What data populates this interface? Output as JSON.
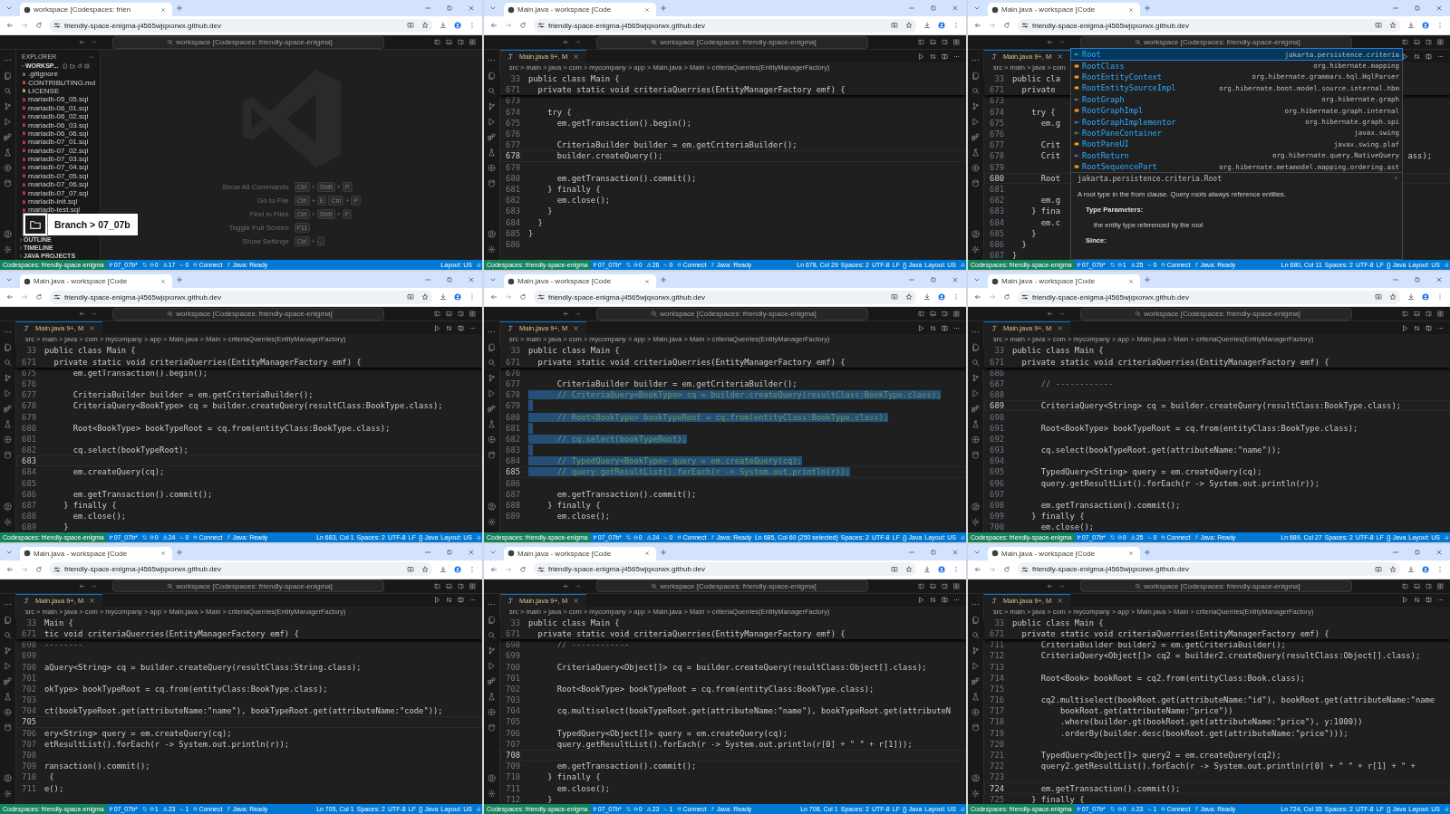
{
  "panels": [
    {
      "kind": "welcome",
      "browser_tab": "workspace [Codespaces: frien",
      "url": "friendly-space-enigma-j4565wjqxorwx.github.dev",
      "command_center": "workspace [Codespaces: friendly-space-enigma]",
      "explorer": {
        "title": "EXPLORER",
        "workspace": "WORKSP...",
        "files": [
          {
            "name": ".gitignore",
            "color": "#6d8086"
          },
          {
            "name": "CONTRIBUTING.md",
            "color": "#e05252"
          },
          {
            "name": "LICENSE",
            "color": "#cbcb41"
          },
          {
            "name": "mariadb-05_05.sql",
            "color": "#d6336c"
          },
          {
            "name": "mariadb-06_01.sql",
            "color": "#d6336c"
          },
          {
            "name": "mariadb-06_02.sql",
            "color": "#d6336c"
          },
          {
            "name": "mariadb-06_03.sql",
            "color": "#d6336c"
          },
          {
            "name": "mariadb-06_06.sql",
            "color": "#d6336c"
          },
          {
            "name": "mariadb-07_01.sql",
            "color": "#d6336c"
          },
          {
            "name": "mariadb-07_02.sql",
            "color": "#d6336c"
          },
          {
            "name": "mariadb-07_03.sql",
            "color": "#d6336c"
          },
          {
            "name": "mariadb-07_04.sql",
            "color": "#d6336c"
          },
          {
            "name": "mariadb-07_05.sql",
            "color": "#d6336c"
          },
          {
            "name": "mariadb-07_06.sql",
            "color": "#d6336c"
          },
          {
            "name": "mariadb-07_07.sql",
            "color": "#d6336c"
          },
          {
            "name": "mariadb-init.sql",
            "color": "#d6336c"
          },
          {
            "name": "mariadb-test.sql",
            "color": "#d6336c"
          }
        ],
        "sections": [
          "OUTLINE",
          "TIMELINE",
          "JAVA PROJECTS"
        ]
      },
      "shortcuts": [
        {
          "label": "Show All Commands",
          "keys": [
            {
              "kind": "key",
              "text": "Ctrl"
            },
            {
              "kind": "sep",
              "text": "+"
            },
            {
              "kind": "key",
              "text": "Shift"
            },
            {
              "kind": "sep",
              "text": "+"
            },
            {
              "kind": "key",
              "text": "P"
            }
          ]
        },
        {
          "label": "Go to File",
          "keys": [
            {
              "kind": "key",
              "text": "Ctrl"
            },
            {
              "kind": "sep",
              "text": "+"
            },
            {
              "kind": "key",
              "text": "E"
            },
            {
              "kind": "key",
              "text": "Ctrl"
            },
            {
              "kind": "sep",
              "text": "+"
            },
            {
              "kind": "key",
              "text": "P"
            }
          ]
        },
        {
          "label": "Find in Files",
          "keys": [
            {
              "kind": "key",
              "text": "Ctrl"
            },
            {
              "kind": "sep",
              "text": "+"
            },
            {
              "kind": "key",
              "text": "Shift"
            },
            {
              "kind": "sep",
              "text": "+"
            },
            {
              "kind": "key",
              "text": "F"
            }
          ]
        },
        {
          "label": "Toggle Full Screen",
          "keys": [
            {
              "kind": "key",
              "text": "F11"
            }
          ]
        },
        {
          "label": "Show Settings",
          "keys": [
            {
              "kind": "key",
              "text": "Ctrl"
            },
            {
              "kind": "sep",
              "text": "+"
            },
            {
              "kind": "key",
              "text": ","
            }
          ]
        }
      ],
      "branch_overlay": "Branch > 07_07b",
      "status": {
        "remote": "Codespaces: friendly-space-enigma",
        "branch": "07_07b*",
        "errors": "0",
        "warnings": "17",
        "ports": "0",
        "connect": "Connect",
        "java": "Java: Ready",
        "right": [
          "Layout: US"
        ]
      }
    },
    {
      "kind": "editor",
      "browser_tab": "Main.java - workspace [Code",
      "url": "friendly-space-enigma-j4565wjqxorwx.github.dev",
      "command_center": "workspace [Codespaces: friendly-space-enigma]",
      "editor_tab": "Main.java 9+, M",
      "breadcrumb": "src > main > java > com > mycompany > app > Main.java > Main > criteriaQuerries(EntityManagerFactory)",
      "sticky": [
        {
          "n": "33",
          "text": "public class Main {"
        },
        {
          "n": "671",
          "text": "  private static void criteriaQuerries(EntityManagerFactory emf) {"
        }
      ],
      "lines": [
        {
          "n": "673",
          "current": false
        },
        {
          "n": "674",
          "text": "    try {",
          "current": false
        },
        {
          "n": "675",
          "text": "      em.getTransaction().begin();",
          "current": false
        },
        {
          "n": "676",
          "current": false
        },
        {
          "n": "677",
          "text": "      CriteriaBuilder builder = em.getCriteriaBuilder();",
          "current": false
        },
        {
          "n": "678",
          "text": "      builder.createQuery();",
          "current": true
        },
        {
          "n": "679",
          "current": false
        },
        {
          "n": "680",
          "text": "      em.getTransaction().commit();",
          "current": false
        },
        {
          "n": "681",
          "text": "    } finally {",
          "current": false
        },
        {
          "n": "682",
          "text": "      em.close();",
          "current": false
        },
        {
          "n": "683",
          "text": "    }",
          "current": false
        },
        {
          "n": "684",
          "text": "  }",
          "current": false
        },
        {
          "n": "685",
          "text": "}",
          "current": false
        },
        {
          "n": "686",
          "current": false
        }
      ],
      "status": {
        "remote": "Codespaces: friendly-space-enigma",
        "branch": "07_07b*",
        "errors": "0",
        "warnings": "26",
        "ports": "0",
        "connect": "Connect",
        "java": "Java: Ready",
        "right": [
          "Ln 678, Col 29",
          "Spaces: 2",
          "UTF-8",
          "LF",
          "{} Java",
          "Layout: US"
        ]
      }
    },
    {
      "kind": "editor",
      "browser_tab": "Main.java - workspace [Code",
      "url": "friendly-space-enigma-j4565wjqxorwx.github.dev",
      "command_center": "workspace [Codespaces: friendly-space-enigma]",
      "editor_tab": "Main.java 9+, M",
      "breadcrumb": "src > main > java > com",
      "sticky": [
        {
          "n": "33",
          "text": "public cla"
        },
        {
          "n": "671",
          "text": "  private"
        }
      ],
      "lines": [
        {
          "n": "673",
          "current": false
        },
        {
          "n": "674",
          "text": "    try {",
          "current": false
        },
        {
          "n": "675",
          "text": "      em.g",
          "current": false
        },
        {
          "n": "676",
          "current": false
        },
        {
          "n": "677",
          "text": "      Crit",
          "current": false
        },
        {
          "n": "678",
          "text": "      Crit",
          "tail": "ass);",
          "current": false
        },
        {
          "n": "679",
          "current": false
        },
        {
          "n": "680",
          "text": "      Root",
          "current": true
        },
        {
          "n": "681",
          "current": false
        },
        {
          "n": "682",
          "text": "      em.g",
          "current": false
        },
        {
          "n": "683",
          "text": "    } fina",
          "current": false
        },
        {
          "n": "684",
          "text": "      em.c",
          "current": false
        },
        {
          "n": "685",
          "text": "    }",
          "current": false
        },
        {
          "n": "686",
          "text": "  }",
          "current": false
        },
        {
          "n": "687",
          "text": "}",
          "current": false
        }
      ],
      "suggest": {
        "items": [
          {
            "label": "Root",
            "detail": "jakarta.persistence.criteria",
            "kind": "interface",
            "selected": true
          },
          {
            "label": "RootClass",
            "detail": "org.hibernate.mapping",
            "kind": "class",
            "selected": false
          },
          {
            "label": "RootEntityContext",
            "detail": "org.hibernate.grammars.hql.HqlParser",
            "kind": "class",
            "selected": false
          },
          {
            "label": "RootEntitySourceImpl",
            "detail": "org.hibernate.boot.model.source.internal.hbm",
            "kind": "class",
            "selected": false
          },
          {
            "label": "RootGraph",
            "detail": "org.hibernate.graph",
            "kind": "interface",
            "selected": false
          },
          {
            "label": "RootGraphImpl",
            "detail": "org.hibernate.graph.internal",
            "kind": "class",
            "selected": false
          },
          {
            "label": "RootGraphImplementor",
            "detail": "org.hibernate.graph.spi",
            "kind": "interface",
            "selected": false
          },
          {
            "label": "RootPaneContainer",
            "detail": "javax.swing",
            "kind": "interface",
            "selected": false
          },
          {
            "label": "RootPaneUI",
            "detail": "javax.swing.plaf",
            "kind": "class",
            "selected": false
          },
          {
            "label": "RootReturn",
            "detail": "org.hibernate.query.NativeQuery",
            "kind": "interface",
            "selected": false
          },
          {
            "label": "RootSequencePart",
            "detail": "org.hibernate.metamodel.mapping.ordering.ast",
            "kind": "class",
            "selected": false
          }
        ],
        "details": {
          "signature": "jakarta.persistence.criteria.Root",
          "description": "A root type in the from clause. Query roots always reference entities.",
          "sections": [
            {
              "title": "Type Parameters:",
              "items": [
                "the entity type referenced by the root"
              ]
            },
            {
              "title": "Since:"
            }
          ]
        }
      },
      "status": {
        "remote": "Codespaces: friendly-space-enigma",
        "branch": "07_07b*",
        "errors": "1",
        "warnings": "25",
        "ports": "0",
        "connect": "Connect",
        "java": "Java: Ready",
        "right": [
          "Ln 680, Col 11",
          "Spaces: 2",
          "UTF-8",
          "LF",
          "{} Java",
          "Layout: US"
        ]
      }
    },
    {
      "kind": "editor",
      "browser_tab": "Main.java - workspace [Code",
      "url": "friendly-space-enigma-j4565wjqxorwx.github.dev",
      "command_center": "workspace [Codespaces: friendly-space-enigma]",
      "editor_tab": "Main.java 9+, M",
      "breadcrumb": "src > main > java > com > mycompany > app > Main.java > Main > criteriaQuerries(EntityManagerFactory)",
      "sticky": [
        {
          "n": "33",
          "text": "public class Main {"
        },
        {
          "n": "671",
          "text": "  private static void criteriaQuerries(EntityManagerFactory emf) {"
        }
      ],
      "lines": [
        {
          "n": "675",
          "text": "      em.getTransaction().begin();",
          "current": false
        },
        {
          "n": "676",
          "current": false
        },
        {
          "n": "677",
          "text": "      CriteriaBuilder builder = em.getCriteriaBuilder();",
          "current": false
        },
        {
          "n": "678",
          "text": "      CriteriaQuery<BookType> cq = builder.createQuery(resultClass:BookType.class);",
          "current": false
        },
        {
          "n": "679",
          "current": false
        },
        {
          "n": "680",
          "text": "      Root<BookType> bookTypeRoot = cq.from(entityClass:BookType.class);",
          "current": false
        },
        {
          "n": "681",
          "current": false
        },
        {
          "n": "682",
          "text": "      cq.select(bookTypeRoot);",
          "current": false
        },
        {
          "n": "683",
          "current": true
        },
        {
          "n": "684",
          "text": "      em.createQuery(cq);",
          "current": false
        },
        {
          "n": "685",
          "current": false
        },
        {
          "n": "686",
          "text": "      em.getTransaction().commit();",
          "current": false
        },
        {
          "n": "687",
          "text": "    } finally {",
          "current": false
        },
        {
          "n": "688",
          "text": "      em.close();",
          "current": false
        },
        {
          "n": "689",
          "text": "    }",
          "current": false
        }
      ],
      "status": {
        "remote": "Codespaces: friendly-space-enigma",
        "branch": "07_07b*",
        "errors": "0",
        "warnings": "24",
        "ports": "0",
        "connect": "Connect",
        "java": "Java: Ready",
        "right": [
          "Ln 683, Col 1",
          "Spaces: 2",
          "UTF-8",
          "LF",
          "{} Java",
          "Layout: US"
        ]
      }
    },
    {
      "kind": "editor",
      "browser_tab": "Main.java - workspace [Code",
      "url": "friendly-space-enigma-j4565wjqxorwx.github.dev",
      "command_center": "workspace [Codespaces: friendly-space-enigma]",
      "editor_tab": "Main.java 9+, M",
      "breadcrumb": "src > main > java > com > mycompany > app > Main.java > Main > criteriaQuerries(EntityManagerFactory)",
      "sticky": [
        {
          "n": "33",
          "text": "public class Main {"
        },
        {
          "n": "671",
          "text": "  private static void criteriaQuerries(EntityManagerFactory emf) {"
        }
      ],
      "lines": [
        {
          "n": "676",
          "current": false,
          "selected": false
        },
        {
          "n": "677",
          "text": "      CriteriaBuilder builder = em.getCriteriaBuilder();",
          "current": false,
          "comment": false,
          "selected": false
        },
        {
          "n": "678",
          "text": "      // CriteriaQuery<BookType> cq = builder.createQuery(resultClass:BookType.class);",
          "current": false,
          "comment": true,
          "selected": true
        },
        {
          "n": "679",
          "current": false,
          "selected": true
        },
        {
          "n": "680",
          "text": "      // Root<BookType> bookTypeRoot = cq.from(entityClass:BookType.class);",
          "current": false,
          "comment": true,
          "selected": true
        },
        {
          "n": "681",
          "current": false,
          "selected": true
        },
        {
          "n": "682",
          "text": "      // cq.select(bookTypeRoot);",
          "current": false,
          "comment": true,
          "selected": true
        },
        {
          "n": "683",
          "current": false,
          "selected": true
        },
        {
          "n": "684",
          "text": "      // TypedQuery<BookType> query = em.createQuery(cq);",
          "current": false,
          "comment": true,
          "selected": true
        },
        {
          "n": "685",
          "text": "      // query.getResultList().forEach(r -> System.out.println(r));",
          "current": true,
          "comment": true,
          "selected": true
        },
        {
          "n": "686",
          "current": false,
          "selected": false
        },
        {
          "n": "687",
          "text": "      em.getTransaction().commit();",
          "current": false,
          "comment": false,
          "selected": false
        },
        {
          "n": "688",
          "text": "    } finally {",
          "current": false,
          "comment": false,
          "selected": false
        },
        {
          "n": "689",
          "text": "      em.close();",
          "current": false,
          "comment": false,
          "selected": false
        }
      ],
      "status": {
        "remote": "Codespaces: friendly-space-enigma",
        "branch": "07_07b*",
        "errors": "0",
        "warnings": "24",
        "ports": "0",
        "connect": "Connect",
        "java": "Java: Ready",
        "right": [
          "Ln 685, Col 60 (250 selected)",
          "Spaces: 2",
          "UTF-8",
          "LF",
          "{} Java",
          "Layout: US"
        ]
      }
    },
    {
      "kind": "editor",
      "browser_tab": "Main.java - workspace [Code",
      "url": "friendly-space-enigma-j4565wjqxorwx.github.dev",
      "command_center": "workspace [Codespaces: friendly-space-enigma]",
      "editor_tab": "Main.java 9+, M",
      "breadcrumb": "src > main > java > com > mycompany > app > Main.java > Main > criteriaQuerries(EntityManagerFactory)",
      "sticky": [
        {
          "n": "33",
          "text": "public class Main {"
        },
        {
          "n": "671",
          "text": "  private static void criteriaQuerries(EntityManagerFactory emf) {"
        }
      ],
      "lines": [
        {
          "n": "686",
          "current": false
        },
        {
          "n": "687",
          "text": "      // ------------",
          "current": false,
          "comment": true
        },
        {
          "n": "688",
          "current": false
        },
        {
          "n": "689",
          "text": "      CriteriaQuery<String> cq = builder.createQuery(resultClass:BookType.class);",
          "current": true,
          "comment": false
        },
        {
          "n": "690",
          "current": false
        },
        {
          "n": "691",
          "text": "      Root<BookType> bookTypeRoot = cq.from(entityClass:BookType.class);",
          "current": false,
          "comment": false
        },
        {
          "n": "692",
          "current": false
        },
        {
          "n": "693",
          "text": "      cq.select(bookTypeRoot.get(attributeName:\"name\"));",
          "current": false,
          "comment": false
        },
        {
          "n": "694",
          "current": false
        },
        {
          "n": "695",
          "text": "      TypedQuery<String> query = em.createQuery(cq);",
          "current": false,
          "comment": false
        },
        {
          "n": "696",
          "text": "      query.getResultList().forEach(r -> System.out.println(r));",
          "current": false,
          "comment": false
        },
        {
          "n": "697",
          "current": false
        },
        {
          "n": "698",
          "text": "      em.getTransaction().commit();",
          "current": false,
          "comment": false
        },
        {
          "n": "699",
          "text": "    } finally {",
          "current": false,
          "comment": false
        },
        {
          "n": "700",
          "text": "      em.close();",
          "current": false,
          "comment": false
        }
      ],
      "status": {
        "remote": "Codespaces: friendly-space-enigma",
        "branch": "07_07b*",
        "errors": "0",
        "warnings": "25",
        "ports": "0",
        "connect": "Connect",
        "java": "Java: Ready",
        "right": [
          "Ln 689, Col 27",
          "Spaces: 2",
          "UTF-8",
          "LF",
          "{} Java",
          "Layout: US"
        ]
      }
    },
    {
      "kind": "editor",
      "browser_tab": "Main.java - workspace [Code",
      "url": "friendly-space-enigma-j4565wjqxorwx.github.dev",
      "command_center": "workspace [Codespaces: friendly-space-enigma]",
      "editor_tab": "Main.java 9+, M",
      "breadcrumb": "src > main > java > com > mycompany > app > Main.java > Main > criteriaQuerries(EntityManagerFactory)",
      "sticky": [
        {
          "n": "33",
          "text": "Main {"
        },
        {
          "n": "671",
          "text": "tic void criteriaQuerries(EntityManagerFactory emf) {"
        }
      ],
      "lines": [
        {
          "n": "698",
          "text": "--------",
          "current": false,
          "comment": true
        },
        {
          "n": "699",
          "current": false
        },
        {
          "n": "700",
          "text": "aQuery<String> cq = builder.createQuery(resultClass:String.class);",
          "current": false,
          "comment": false
        },
        {
          "n": "701",
          "current": false
        },
        {
          "n": "702",
          "text": "okType> bookTypeRoot = cq.from(entityClass:BookType.class);",
          "current": false,
          "comment": false
        },
        {
          "n": "703",
          "current": false
        },
        {
          "n": "704",
          "text": "ct(bookTypeRoot.get(attributeName:\"name\"), bookTypeRoot.get(attributeName:\"code\"));",
          "current": false,
          "comment": false
        },
        {
          "n": "705",
          "current": true
        },
        {
          "n": "706",
          "text": "ery<String> query = em.createQuery(cq);",
          "current": false,
          "comment": false
        },
        {
          "n": "707",
          "text": "etResultList().forEach(r -> System.out.println(r));",
          "current": false,
          "comment": false
        },
        {
          "n": "708",
          "current": false
        },
        {
          "n": "709",
          "text": "ransaction().commit();",
          "current": false,
          "comment": false
        },
        {
          "n": "710",
          "text": " {",
          "current": false,
          "comment": false
        },
        {
          "n": "711",
          "text": "e();",
          "current": false,
          "comment": false
        }
      ],
      "status": {
        "remote": "Codespaces: friendly-space-enigma",
        "branch": "07_07b*",
        "errors": "1",
        "warnings": "23",
        "ports": "1",
        "connect": "Connect",
        "java": "Java: Ready",
        "right": [
          "Ln 705, Col 1",
          "Spaces: 2",
          "UTF-8",
          "LF",
          "{} Java",
          "Layout: US"
        ]
      }
    },
    {
      "kind": "editor",
      "browser_tab": "Main.java - workspace [Code",
      "url": "friendly-space-enigma-j4565wjqxorwx.github.dev",
      "command_center": "workspace [Codespaces: friendly-space-enigma]",
      "editor_tab": "Main.java 9+, M",
      "breadcrumb": "src > main > java > com > mycompany > app > Main.java > Main > criteriaQuerries(EntityManagerFactory)",
      "sticky": [
        {
          "n": "33",
          "text": "public class Main {"
        },
        {
          "n": "671",
          "text": "  private static void criteriaQuerries(EntityManagerFactory emf) {"
        }
      ],
      "lines": [
        {
          "n": "698",
          "text": "      // ------------",
          "current": false,
          "comment": true
        },
        {
          "n": "699",
          "current": false
        },
        {
          "n": "700",
          "text": "      CriteriaQuery<Object[]> cq = builder.createQuery(resultClass:Object[].class);",
          "current": false,
          "comment": false
        },
        {
          "n": "701",
          "current": false
        },
        {
          "n": "702",
          "text": "      Root<BookType> bookTypeRoot = cq.from(entityClass:BookType.class);",
          "current": false,
          "comment": false
        },
        {
          "n": "703",
          "current": false
        },
        {
          "n": "704",
          "text": "      cq.multiselect(bookTypeRoot.get(attributeName:\"name\"), bookTypeRoot.get(attributeN",
          "current": false,
          "comment": false
        },
        {
          "n": "705",
          "current": false
        },
        {
          "n": "706",
          "text": "      TypedQuery<Object[]> query = em.createQuery(cq);",
          "current": false,
          "comment": false
        },
        {
          "n": "707",
          "text": "      query.getResultList().forEach(r -> System.out.println(r[0] + \" \" + r[1]));",
          "current": false,
          "comment": false
        },
        {
          "n": "708",
          "current": true
        },
        {
          "n": "709",
          "text": "      em.getTransaction().commit();",
          "current": false,
          "comment": false
        },
        {
          "n": "710",
          "text": "    } finally {",
          "current": false,
          "comment": false
        },
        {
          "n": "711",
          "text": "      em.close();",
          "current": false,
          "comment": false
        },
        {
          "n": "712",
          "text": "    }",
          "current": false,
          "comment": false
        }
      ],
      "status": {
        "remote": "Codespaces: friendly-space-enigma",
        "branch": "07_07b*",
        "errors": "0",
        "warnings": "23",
        "ports": "1",
        "connect": "Connect",
        "java": "Java: Ready",
        "right": [
          "Ln 708, Col 1",
          "Spaces: 2",
          "UTF-8",
          "LF",
          "{} Java",
          "Layout: US"
        ]
      }
    },
    {
      "kind": "editor",
      "browser_tab": "Main.java - workspace [Code",
      "url": "friendly-space-enigma-j4565wjqxorwx.github.dev",
      "command_center": "workspace [Codespaces: friendly-space-enigma]",
      "editor_tab": "Main.java 9+, M",
      "breadcrumb": "src > main > java > com > mycompany > app > Main.java > Main > criteriaQuerries(EntityManagerFactory)",
      "sticky": [
        {
          "n": "33",
          "text": "public class Main {"
        },
        {
          "n": "671",
          "text": "  private static void criteriaQuerries(EntityManagerFactory emf) {"
        }
      ],
      "lines": [
        {
          "n": "711",
          "text": "      CriteriaBuilder builder2 = em.getCriteriaBuilder();",
          "current": false
        },
        {
          "n": "712",
          "text": "      CriteriaQuery<Object[]> cq2 = builder2.createQuery(resultClass:Object[].class);",
          "current": false
        },
        {
          "n": "713",
          "current": false
        },
        {
          "n": "714",
          "text": "      Root<Book> bookRoot = cq2.from(entityClass:Book.class);",
          "current": false
        },
        {
          "n": "715",
          "current": false
        },
        {
          "n": "716",
          "text": "      cq2.multiselect(bookRoot.get(attributeName:\"id\"), bookRoot.get(attributeName:\"name",
          "current": false
        },
        {
          "n": "717",
          "text": "          bookRoot.get(attributeName:\"price\"))",
          "current": false
        },
        {
          "n": "718",
          "text": "          .where(builder.gt(bookRoot.get(attributeName:\"price\"), y:1000))",
          "current": false
        },
        {
          "n": "719",
          "text": "          .orderBy(builder.desc(bookRoot.get(attributeName:\"price\")));",
          "current": false
        },
        {
          "n": "720",
          "current": false
        },
        {
          "n": "721",
          "text": "      TypedQuery<Object[]> query2 = em.createQuery(cq2);",
          "current": false
        },
        {
          "n": "722",
          "text": "      query2.getResultList().forEach(r -> System.out.println(r[0] + \" \" + r[1] + \" +",
          "current": false
        },
        {
          "n": "723",
          "current": false
        },
        {
          "n": "724",
          "text": "      em.getTransaction().commit();",
          "current": true
        },
        {
          "n": "725",
          "text": "    } finally {",
          "current": false
        }
      ],
      "status": {
        "remote": "Codespaces: friendly-space-enigma",
        "branch": "07_07b*",
        "errors": "0",
        "warnings": "23",
        "ports": "1",
        "connect": "Connect",
        "java": "Java: Ready",
        "right": [
          "Ln 724, Col 35",
          "Spaces: 2",
          "UTF-8",
          "LF",
          "{} Java",
          "Layout: US"
        ]
      }
    }
  ]
}
